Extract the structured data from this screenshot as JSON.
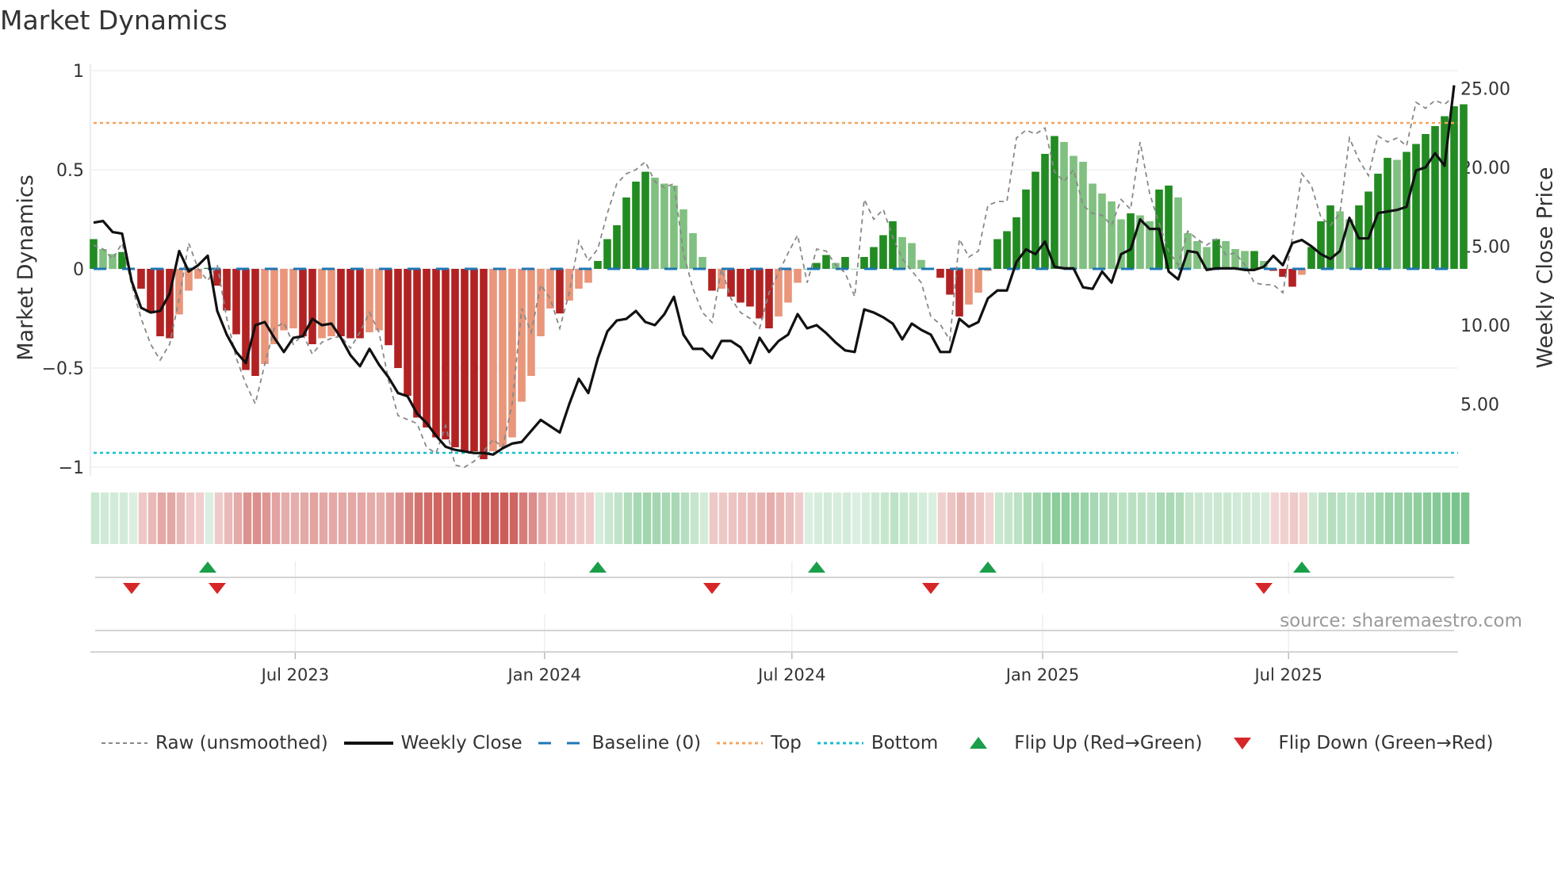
{
  "chart_data": {
    "type": "bar",
    "title": "Market Dynamics",
    "ylabel": "Market Dynamics",
    "y2label": "Weekly Close Price",
    "ylim": [
      -1.05,
      1.05
    ],
    "y2lim": [
      0,
      30
    ],
    "yticks": [
      {
        "v": 1,
        "label": "1"
      },
      {
        "v": 0.5,
        "label": "0.5"
      },
      {
        "v": 0,
        "label": "0"
      },
      {
        "v": -0.5,
        "label": "−0.5"
      },
      {
        "v": -1,
        "label": "−1"
      }
    ],
    "y2ticks": [
      {
        "v": 25,
        "label": "25.00"
      },
      {
        "v": 20,
        "label": "20.00"
      },
      {
        "v": 15,
        "label": "15.00"
      },
      {
        "v": 10,
        "label": "10.00"
      },
      {
        "v": 5,
        "label": "5.00"
      }
    ],
    "xticks": [
      {
        "week": 21.2,
        "label": "Jul 2023"
      },
      {
        "week": 47.4,
        "label": "Jan 2024"
      },
      {
        "week": 73.4,
        "label": "Jul 2024"
      },
      {
        "week": 99.75,
        "label": "Jan 2025"
      },
      {
        "week": 125.6,
        "label": "Jul 2025"
      }
    ],
    "top_level": 0.736,
    "bottom_level": -0.928,
    "baseline": 0,
    "smoothed": [
      0.15,
      0.1,
      0.075,
      0.085,
      0,
      -0.1,
      -0.22,
      -0.34,
      -0.35,
      -0.23,
      -0.11,
      -0.05,
      0.005,
      -0.085,
      -0.21,
      -0.33,
      -0.51,
      -0.54,
      -0.48,
      -0.38,
      -0.31,
      -0.3,
      -0.34,
      -0.38,
      -0.35,
      -0.34,
      -0.34,
      -0.35,
      -0.35,
      -0.32,
      -0.31,
      -0.385,
      -0.5,
      -0.64,
      -0.75,
      -0.8,
      -0.85,
      -0.86,
      -0.9,
      -0.92,
      -0.92,
      -0.96,
      -0.92,
      -0.9,
      -0.85,
      -0.67,
      -0.54,
      -0.34,
      -0.2,
      -0.225,
      -0.16,
      -0.1,
      -0.07,
      0.04,
      0.15,
      0.22,
      0.36,
      0.44,
      0.49,
      0.46,
      0.43,
      0.42,
      0.3,
      0.18,
      0.06,
      -0.11,
      -0.1,
      -0.14,
      -0.17,
      -0.19,
      -0.25,
      -0.3,
      -0.24,
      -0.17,
      -0.07,
      0,
      0.03,
      0.07,
      0.03,
      0.06,
      0,
      0.06,
      0.11,
      0.17,
      0.24,
      0.16,
      0.13,
      0.045,
      0,
      -0.045,
      -0.13,
      -0.24,
      -0.18,
      -0.12,
      -0.01,
      0.15,
      0.19,
      0.26,
      0.4,
      0.49,
      0.58,
      0.67,
      0.64,
      0.57,
      0.54,
      0.43,
      0.38,
      0.34,
      0.25,
      0.28,
      0.27,
      0.24,
      0.4,
      0.42,
      0.36,
      0.18,
      0.14,
      0.11,
      0.15,
      0.14,
      0.1,
      0.09,
      0.09,
      0.04,
      -0.01,
      -0.04,
      -0.09,
      -0.03,
      0.11,
      0.24,
      0.32,
      0.29,
      0.25,
      0.32,
      0.39,
      0.48,
      0.56,
      0.55,
      0.59,
      0.63,
      0.68,
      0.72,
      0.77,
      0.82,
      0.83
    ],
    "raw": [
      0.12,
      0.1,
      0.05,
      0.13,
      -0.08,
      -0.25,
      -0.38,
      -0.46,
      -0.38,
      -0.15,
      0.13,
      0.0,
      -0.06,
      0.02,
      -0.25,
      -0.45,
      -0.58,
      -0.68,
      -0.48,
      -0.3,
      -0.27,
      -0.38,
      -0.33,
      -0.43,
      -0.37,
      -0.35,
      -0.34,
      -0.4,
      -0.32,
      -0.22,
      -0.32,
      -0.56,
      -0.74,
      -0.76,
      -0.78,
      -0.9,
      -0.93,
      -0.79,
      -0.99,
      -1.0,
      -0.97,
      -0.92,
      -0.86,
      -0.9,
      -0.68,
      -0.2,
      -0.32,
      -0.08,
      -0.15,
      -0.3,
      -0.12,
      0.14,
      0.04,
      0.1,
      0.28,
      0.43,
      0.48,
      0.5,
      0.54,
      0.44,
      0.41,
      0.43,
      0.08,
      -0.1,
      -0.22,
      -0.27,
      0.0,
      -0.15,
      -0.22,
      -0.25,
      -0.3,
      -0.12,
      -0.02,
      0.08,
      0.17,
      -0.07,
      0.1,
      0.09,
      0.02,
      -0.02,
      -0.14,
      0.35,
      0.25,
      0.3,
      0.16,
      0.05,
      -0.01,
      -0.07,
      -0.24,
      -0.28,
      -0.36,
      0.15,
      0.06,
      0.09,
      0.32,
      0.34,
      0.34,
      0.66,
      0.7,
      0.68,
      0.71,
      0.49,
      0.44,
      0.5,
      0.32,
      0.28,
      0.27,
      0.22,
      0.35,
      0.3,
      0.64,
      0.38,
      0.23,
      0.09,
      0.02,
      0.19,
      0.15,
      0.12,
      0.15,
      0.07,
      0.08,
      0.02,
      -0.07,
      -0.08,
      -0.08,
      -0.12,
      0.16,
      0.48,
      0.42,
      0.26,
      0.22,
      0.28,
      0.66,
      0.55,
      0.47,
      0.67,
      0.64,
      0.66,
      0.62,
      0.84,
      0.81,
      0.85,
      0.83,
      0.87
    ],
    "close": [
      16.5,
      16.6,
      15.9,
      15.8,
      12.8,
      11.1,
      10.8,
      10.9,
      12.0,
      14.7,
      13.4,
      13.8,
      14.4,
      10.9,
      9.4,
      8.3,
      7.6,
      10.0,
      10.2,
      9.2,
      8.3,
      9.2,
      9.3,
      10.4,
      10.0,
      10.1,
      9.2,
      8.1,
      7.4,
      8.5,
      7.5,
      6.7,
      5.7,
      5.5,
      4.4,
      3.8,
      3.0,
      2.3,
      2.1,
      2.0,
      1.9,
      1.9,
      1.8,
      2.2,
      2.5,
      2.6,
      3.3,
      4.0,
      3.6,
      3.2,
      5.0,
      6.6,
      5.7,
      7.9,
      9.6,
      10.3,
      10.4,
      10.9,
      10.2,
      10.0,
      10.7,
      11.8,
      9.4,
      8.5,
      8.5,
      7.9,
      9.0,
      9.0,
      8.6,
      7.6,
      9.2,
      8.3,
      9.0,
      9.4,
      10.7,
      9.8,
      10.0,
      9.5,
      8.9,
      8.4,
      8.3,
      11.0,
      10.8,
      10.5,
      10.1,
      9.1,
      10.1,
      9.7,
      9.4,
      8.3,
      8.3,
      10.4,
      9.9,
      10.2,
      11.7,
      12.2,
      12.2,
      14.0,
      14.8,
      14.5,
      15.3,
      13.7,
      13.6,
      13.6,
      12.4,
      12.3,
      13.4,
      12.7,
      14.5,
      14.8,
      16.7,
      16.1,
      16.1,
      13.4,
      12.9,
      14.7,
      14.6,
      13.5,
      13.6,
      13.6,
      13.6,
      13.5,
      13.5,
      13.7,
      14.4,
      13.8,
      15.2,
      15.4,
      15.0,
      14.5,
      14.2,
      14.7,
      16.8,
      15.5,
      15.5,
      17.1,
      17.2,
      17.3,
      17.5,
      19.8,
      20.0,
      20.9,
      20.1,
      25.2
    ],
    "flip_up_weeks": [
      12,
      53,
      76,
      94,
      127
    ],
    "flip_down_weeks": [
      4,
      13,
      65,
      88,
      123
    ],
    "colors": {
      "strong_green": "#228b22",
      "weak_green": "#80c080",
      "strong_red": "#b22222",
      "weak_red": "#e9967a",
      "baseline": "#1f77b4",
      "top": "#f4a460",
      "bottom": "#17becf",
      "flip_up": "#1a9e4a",
      "flip_down": "#d62728",
      "close": "#111111",
      "raw": "#888888"
    },
    "legend": {
      "raw": "Raw (unsmoothed)",
      "close": "Weekly Close",
      "baseline": "Baseline (0)",
      "top": "Top",
      "bottom": "Bottom",
      "flip_up": "Flip Up (Red→Green)",
      "flip_down": "Flip Down (Green→Red)"
    },
    "legend_position": "bottom",
    "source": "source: sharemaestro.com"
  }
}
